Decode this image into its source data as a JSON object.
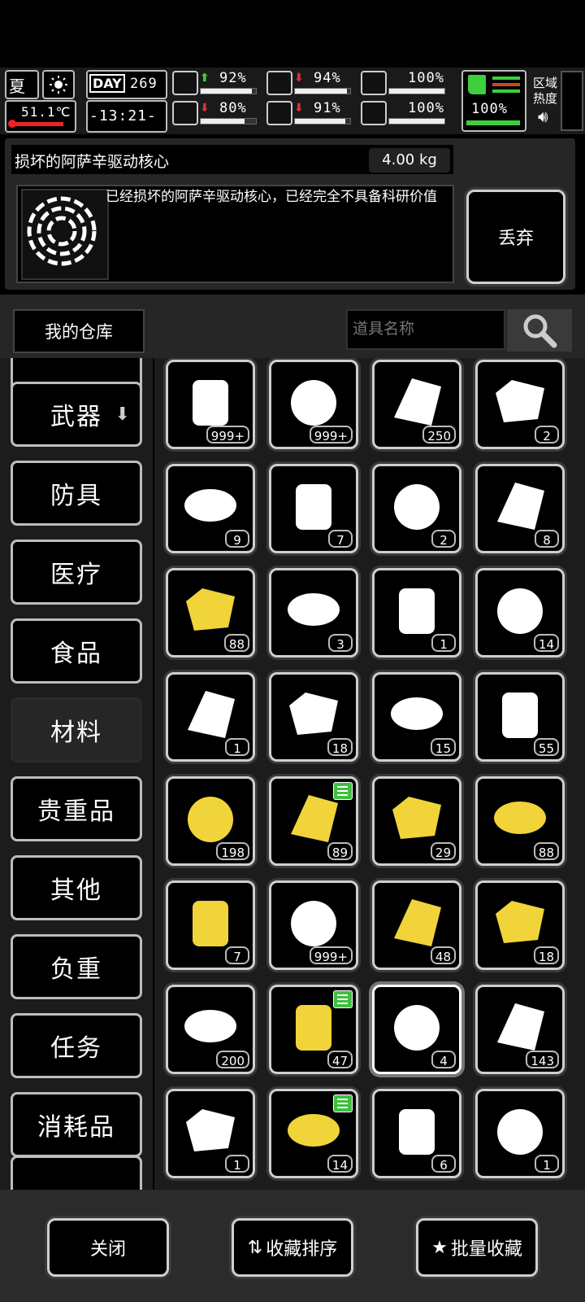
{
  "status": {
    "season": "夏",
    "temperature": "51.1℃",
    "day_label": "DAY",
    "day_number": "269",
    "time": "-13:21-",
    "stats": [
      {
        "name": "health",
        "icon": "medkit-icon",
        "trend": "up",
        "value": "92%",
        "level": 0.92
      },
      {
        "name": "hunger",
        "icon": "stomach-icon",
        "trend": "down",
        "value": "94%",
        "level": 0.94
      },
      {
        "name": "energy",
        "icon": "pill-icon",
        "trend": "none",
        "value": "100%",
        "level": 1.0
      },
      {
        "name": "mood",
        "icon": "brain-icon",
        "trend": "down",
        "value": "80%",
        "level": 0.8
      },
      {
        "name": "thirst",
        "icon": "water-drop-icon",
        "trend": "down",
        "value": "91%",
        "level": 0.91
      },
      {
        "name": "heart",
        "icon": "heart-icon",
        "trend": "none",
        "value": "100%",
        "level": 1.0
      }
    ],
    "boot_value": "100%",
    "zone_heat_label": "区域\n热度"
  },
  "detail": {
    "name": "损坏的阿萨辛驱动核心",
    "weight": "4.00 kg",
    "description": "已经损坏的阿萨辛驱动核心，已经完全不具备科研价值",
    "discard_label": "丢弃"
  },
  "warehouse": {
    "title": "我的仓库",
    "search_placeholder": "道具名称"
  },
  "categories": [
    {
      "label": "武器",
      "has_arrow": true
    },
    {
      "label": "防具"
    },
    {
      "label": "医疗"
    },
    {
      "label": "食品"
    },
    {
      "label": "材料",
      "active": true
    },
    {
      "label": "贵重品"
    },
    {
      "label": "其他"
    },
    {
      "label": "负重"
    },
    {
      "label": "任务"
    },
    {
      "label": "消耗品"
    }
  ],
  "items": [
    {
      "icon": "spray-bottle-icon",
      "qty": "999+"
    },
    {
      "icon": "plastic-bottle-icon",
      "qty": "999+"
    },
    {
      "icon": "oil-barrel-icon",
      "qty": "250"
    },
    {
      "icon": "cloth-icon",
      "qty": "2"
    },
    {
      "icon": "sack-icon",
      "qty": "9"
    },
    {
      "icon": "cotton-bag-icon",
      "qty": "7"
    },
    {
      "icon": "leather-icon",
      "qty": "2"
    },
    {
      "icon": "vine-icon",
      "qty": "8"
    },
    {
      "icon": "wood-planks-icon",
      "qty": "88"
    },
    {
      "icon": "pistol-parts-icon",
      "qty": "3"
    },
    {
      "icon": "rifle-icon",
      "qty": "1"
    },
    {
      "icon": "pipe-icon",
      "qty": "14"
    },
    {
      "icon": "gun-parts-icon",
      "qty": "1"
    },
    {
      "icon": "log-icon",
      "qty": "18"
    },
    {
      "icon": "leaf-icon",
      "qty": "15"
    },
    {
      "icon": "metal-sheet-icon",
      "qty": "55"
    },
    {
      "icon": "flask-icon",
      "qty": "198"
    },
    {
      "icon": "circuit-part-icon",
      "qty": "89",
      "fav": true
    },
    {
      "icon": "wire-icon",
      "qty": "29"
    },
    {
      "icon": "gold-planks-icon",
      "qty": "88"
    },
    {
      "icon": "engine-core-icon",
      "qty": "7"
    },
    {
      "icon": "filter-mesh-icon",
      "qty": "999+"
    },
    {
      "icon": "cup-icon",
      "qty": "48"
    },
    {
      "icon": "gold-board-icon",
      "qty": "18"
    },
    {
      "icon": "tape-roll-icon",
      "qty": "200"
    },
    {
      "icon": "gold-nuggets-icon",
      "qty": "47",
      "fav": true
    },
    {
      "icon": "damaged-core-icon",
      "qty": "4",
      "selected": true
    },
    {
      "icon": "glass-sheet-icon",
      "qty": "143"
    },
    {
      "icon": "cylinder-part-icon",
      "qty": "1"
    },
    {
      "icon": "gears-icon",
      "qty": "14",
      "fav": true
    },
    {
      "icon": "bowl-icon",
      "qty": "6"
    },
    {
      "icon": "machine-part-icon",
      "qty": "1"
    }
  ],
  "footer": {
    "close_label": "关闭",
    "sort_label": "收藏排序",
    "batch_label": "批量收藏"
  }
}
